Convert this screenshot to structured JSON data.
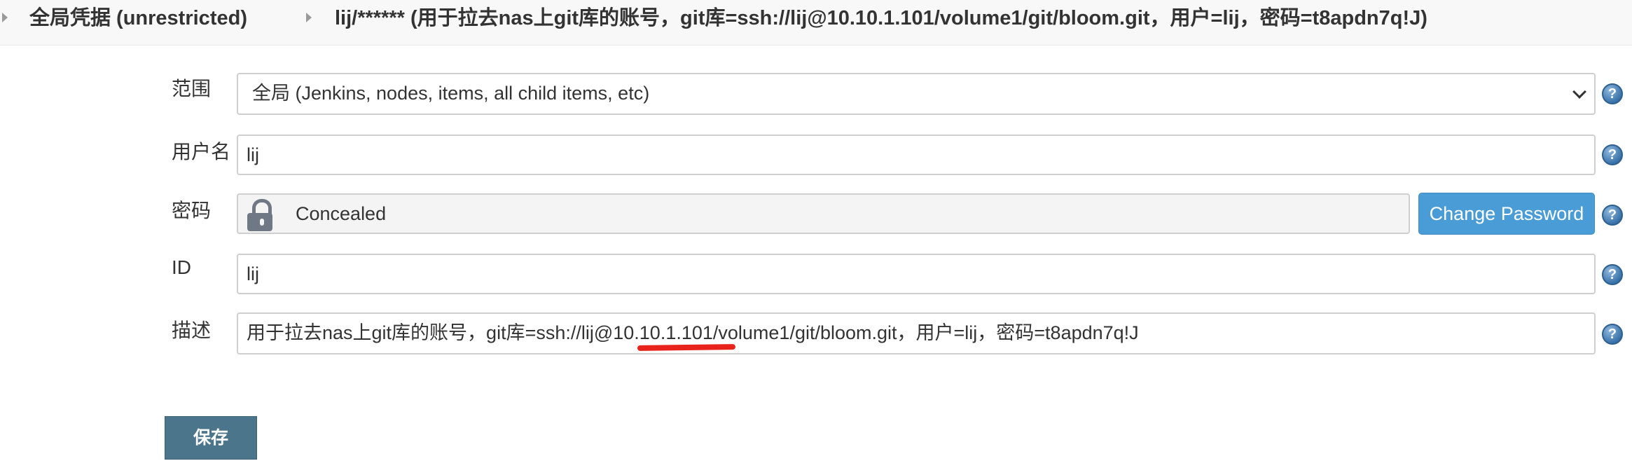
{
  "breadcrumb": {
    "store": "全局凭据 (unrestricted)",
    "credential": "lij/****** (用于拉去nas上git库的账号，git库=ssh://lij@10.10.1.101/volume1/git/bloom.git，用户=lij，密码=t8apdn7q!J)"
  },
  "form": {
    "scope": {
      "label": "范围",
      "value": "全局 (Jenkins, nodes, items, all child items, etc)"
    },
    "username": {
      "label": "用户名",
      "value": "lij"
    },
    "password": {
      "label": "密码",
      "value": "Concealed",
      "change_button": "Change Password"
    },
    "id": {
      "label": "ID",
      "value": "lij"
    },
    "description": {
      "label": "描述",
      "value": "用于拉去nas上git库的账号，git库=ssh://lij@10.10.1.101/volume1/git/bloom.git，用户=lij，密码=t8apdn7q!J"
    }
  },
  "help_icon_glyph": "?",
  "save_button": "保存",
  "colors": {
    "primary_button": "#4a9cd6",
    "save_button": "#4b758b",
    "annotation_underline": "#e8231b",
    "help_icon": "#3a74ab"
  },
  "icons": [
    "chevron-right-icon",
    "chevron-down-icon",
    "lock-icon",
    "help-icon"
  ]
}
